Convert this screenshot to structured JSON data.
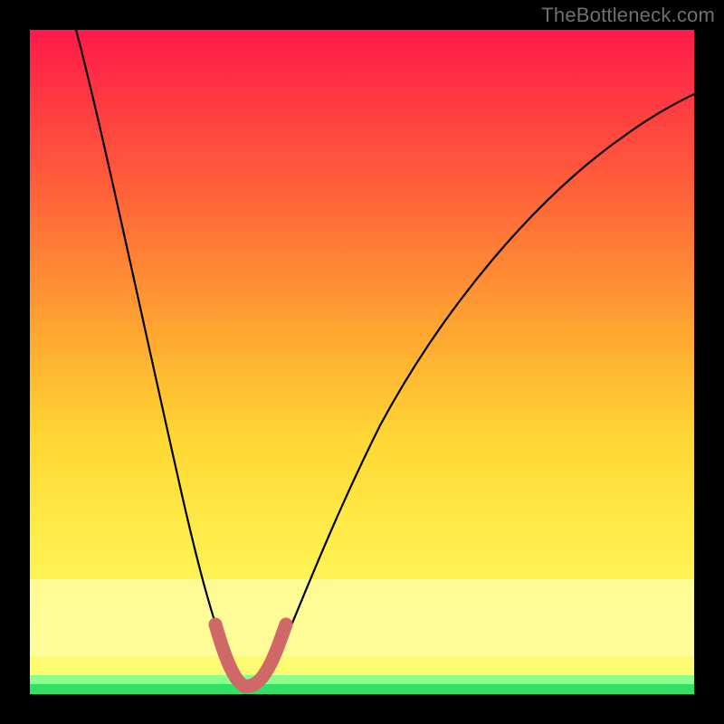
{
  "watermark": "TheBottleneck.com",
  "chart_data": {
    "type": "line",
    "title": "",
    "xlabel": "",
    "ylabel": "",
    "xlim": [
      0,
      100
    ],
    "ylim": [
      0,
      100
    ],
    "background_gradient": {
      "top": "#ff1a4a",
      "mid_upper": "#ff7a2f",
      "mid": "#ffd633",
      "lower": "#ffff66",
      "band": "#ffffcc",
      "bottom": "#33ff66"
    },
    "series": [
      {
        "name": "bottleneck-curve",
        "color": "#000000",
        "x": [
          7,
          10,
          13,
          16,
          19,
          22,
          25,
          27,
          28.5,
          30,
          31,
          32,
          33.5,
          35,
          37,
          40,
          45,
          50,
          55,
          60,
          65,
          70,
          75,
          80,
          85,
          90,
          95,
          99
        ],
        "y": [
          100,
          88,
          76,
          64,
          52,
          40,
          26,
          14,
          6,
          2,
          1,
          1,
          2,
          5,
          12,
          22,
          36,
          47,
          55,
          62,
          68,
          73,
          77,
          80.5,
          83.5,
          86,
          88,
          89.5
        ]
      },
      {
        "name": "optimal-zone",
        "color": "#d46a6a",
        "x": [
          27.5,
          28.5,
          30,
          31,
          32,
          33,
          34,
          35
        ],
        "y": [
          11,
          5,
          2,
          1,
          1,
          2,
          4,
          9
        ]
      }
    ]
  }
}
